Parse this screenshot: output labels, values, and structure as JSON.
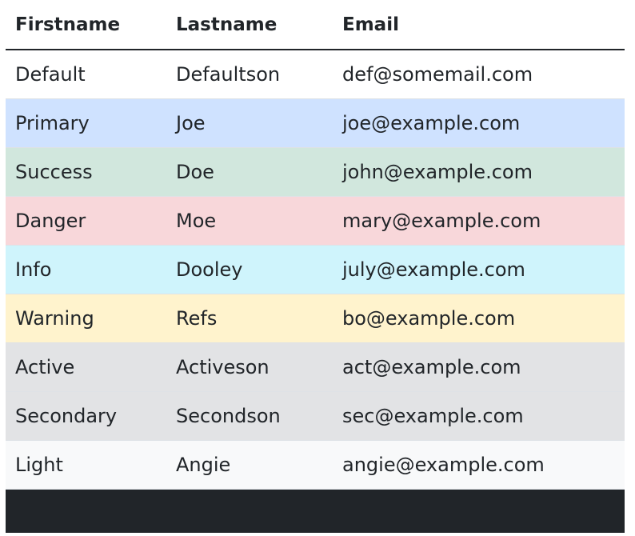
{
  "table": {
    "headers": [
      "Firstname",
      "Lastname",
      "Email"
    ],
    "rows": [
      {
        "variant": "Default",
        "bg": "#ffffff",
        "cells": [
          "Default",
          "Defaultson",
          "def@somemail.com"
        ]
      },
      {
        "variant": "Primary",
        "bg": "#cfe2ff",
        "cells": [
          "Primary",
          "Joe",
          "joe@example.com"
        ]
      },
      {
        "variant": "Success",
        "bg": "#d1e7dd",
        "cells": [
          "Success",
          "Doe",
          "john@example.com"
        ]
      },
      {
        "variant": "Danger",
        "bg": "#f8d7da",
        "cells": [
          "Danger",
          "Moe",
          "mary@example.com"
        ]
      },
      {
        "variant": "Info",
        "bg": "#cff4fc",
        "cells": [
          "Info",
          "Dooley",
          "july@example.com"
        ]
      },
      {
        "variant": "Warning",
        "bg": "#fff3cd",
        "cells": [
          "Warning",
          "Refs",
          "bo@example.com"
        ]
      },
      {
        "variant": "Active",
        "bg": "#e2e3e5",
        "cells": [
          "Active",
          "Activeson",
          "act@example.com"
        ]
      },
      {
        "variant": "Secondary",
        "bg": "#e2e3e5",
        "cells": [
          "Secondary",
          "Secondson",
          "sec@example.com"
        ]
      },
      {
        "variant": "Light",
        "bg": "#f8f9fa",
        "cells": [
          "Light",
          "Angie",
          "angie@example.com"
        ]
      },
      {
        "variant": "Dark",
        "bg": "#212529",
        "cells": [
          "",
          "",
          ""
        ]
      }
    ]
  }
}
